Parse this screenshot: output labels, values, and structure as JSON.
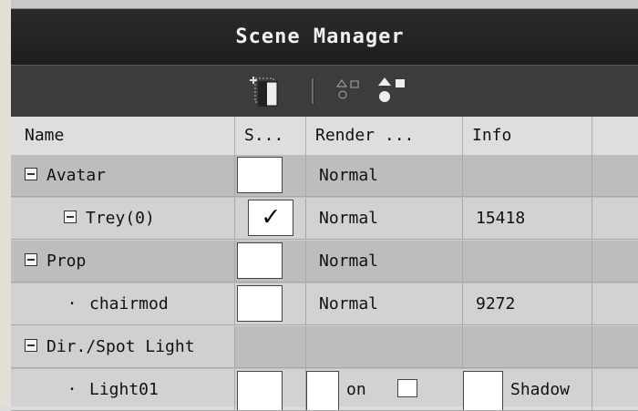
{
  "panel": {
    "title": "Scene Manager"
  },
  "toolbar": {
    "icons": [
      "new-layer-icon",
      "select-objects-icon",
      "shapes-icon"
    ]
  },
  "columns": [
    "Name",
    "S...",
    "Render ...",
    "Info"
  ],
  "rows": [
    {
      "name": "Avatar",
      "marker": "expander",
      "selected": false,
      "render": "Normal",
      "info": ""
    },
    {
      "name": "Trey(0)",
      "marker": "expander",
      "selected": true,
      "check_glyph": "✓",
      "render": "Normal",
      "info": "15418"
    },
    {
      "name": "Prop",
      "marker": "expander",
      "selected": false,
      "render": "Normal",
      "info": ""
    },
    {
      "name": "chairmod",
      "marker": "bullet",
      "bullet_glyph": "·",
      "selected": false,
      "render": "Normal",
      "info": "9272"
    },
    {
      "name": "Dir./Spot Light",
      "marker": "expander",
      "render": "",
      "info": ""
    },
    {
      "name": "Light01",
      "marker": "bullet",
      "bullet_glyph": "·",
      "selected": false,
      "render": "on",
      "info": "Shadow"
    }
  ]
}
